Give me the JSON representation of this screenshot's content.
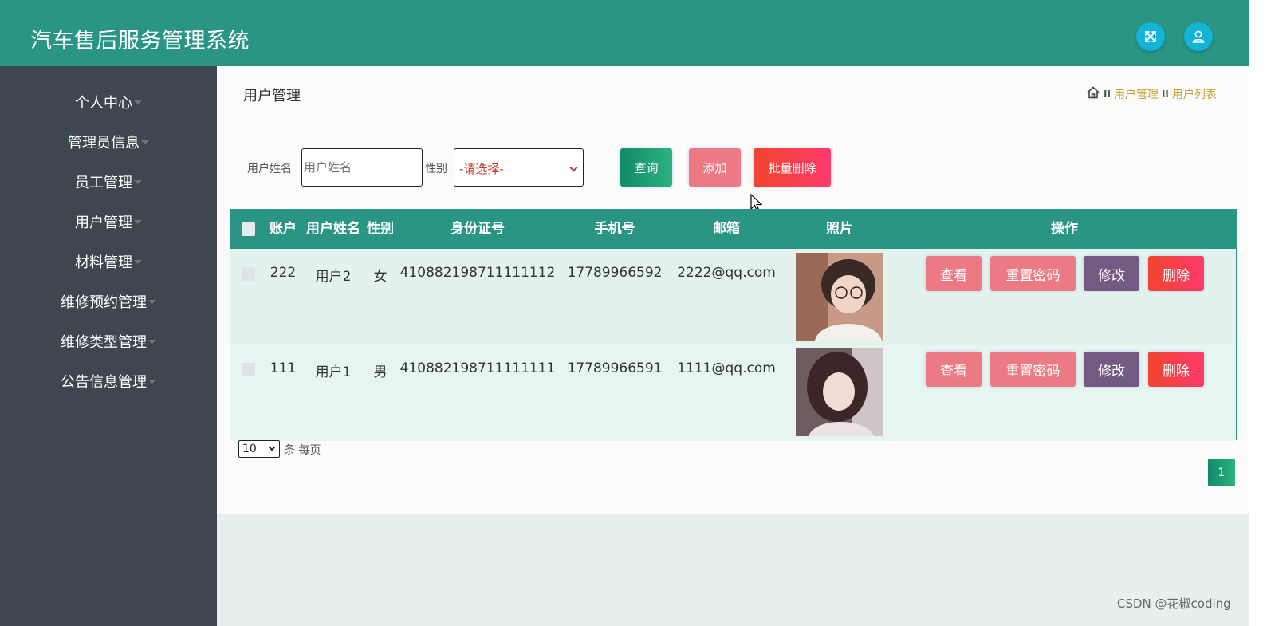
{
  "header": {
    "title": "汽车售后服务管理系统",
    "icons": [
      "fullscreen-icon",
      "user-icon"
    ]
  },
  "sidebar": {
    "items": [
      {
        "label": "个人中心"
      },
      {
        "label": "管理员信息"
      },
      {
        "label": "员工管理"
      },
      {
        "label": "用户管理"
      },
      {
        "label": "材料管理"
      },
      {
        "label": "维修预约管理"
      },
      {
        "label": "维修类型管理"
      },
      {
        "label": "公告信息管理"
      }
    ]
  },
  "page": {
    "title": "用户管理",
    "breadcrumb": {
      "home_icon": "home-icon",
      "separator": "II",
      "items": [
        "用户管理",
        "用户列表"
      ]
    }
  },
  "search": {
    "name_label": "用户姓名",
    "name_placeholder": "用户姓名",
    "gender_label": "性别",
    "gender_selected": "-请选择-",
    "query_label": "查询",
    "add_label": "添加",
    "batch_delete_label": "批量删除"
  },
  "table": {
    "columns": [
      "账户",
      "用户姓名",
      "性别",
      "身份证号",
      "手机号",
      "邮箱",
      "照片",
      "操作"
    ],
    "rows": [
      {
        "account": "222",
        "name": "用户2",
        "gender": "女",
        "id_number": "410882198711111112",
        "phone": "17789966592",
        "email": "2222@qq.com",
        "photo": "user-photo-2"
      },
      {
        "account": "111",
        "name": "用户1",
        "gender": "男",
        "id_number": "410882198711111111",
        "phone": "17789966591",
        "email": "1111@qq.com",
        "photo": "user-photo-1"
      }
    ],
    "actions": {
      "view": "查看",
      "reset_password": "重置密码",
      "edit": "修改",
      "delete": "删除"
    }
  },
  "pagination": {
    "per_page_value": "10",
    "per_page_label": "条 每页",
    "current_page": "1"
  },
  "colors": {
    "primary": "#2a9585",
    "sidebar": "#3e4750",
    "pink_button": "#ec7a85",
    "purple_button": "#735a80",
    "danger_button": "#f0452f",
    "breadcrumb_link": "#c8a034"
  },
  "watermark": "CSDN @花椒coding"
}
